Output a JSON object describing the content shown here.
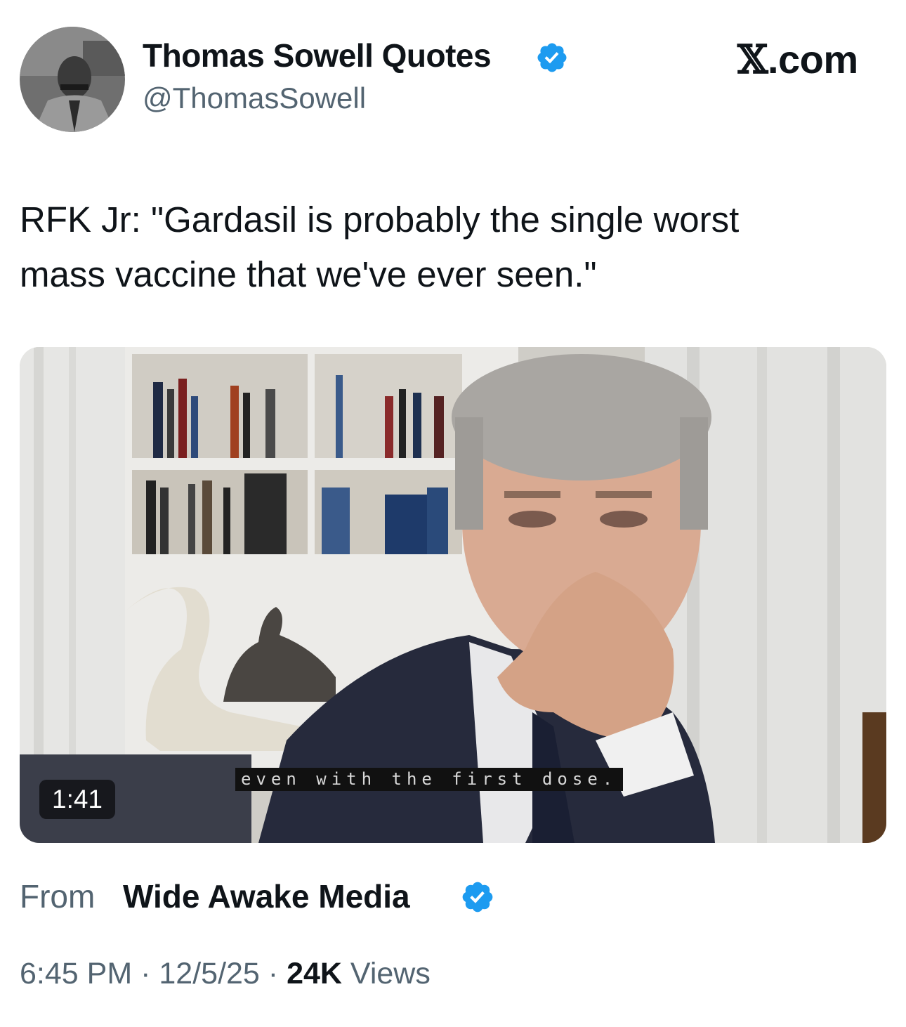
{
  "author": {
    "display_name": "Thomas Sowell Quotes",
    "handle": "@ThomasSowell",
    "verified_icon": "verified-badge-icon"
  },
  "site": {
    "logo_glyph": "𝕏",
    "logo_suffix": ".com"
  },
  "tweet": {
    "text_line1": "RFK Jr: \"Gardasil is probably the single worst",
    "text_line2": "mass vaccine that we've ever seen.\""
  },
  "media": {
    "duration": "1:41",
    "caption": "even with the first dose."
  },
  "source": {
    "prefix": "From",
    "name": "Wide Awake Media",
    "verified_icon": "verified-badge-icon"
  },
  "footer": {
    "time": "6:45 PM",
    "sep": "·",
    "date": "12/5/25",
    "views_count": "24K",
    "views_label": "Views"
  },
  "colors": {
    "verified": "#1d9bf0",
    "secondary_text": "#536471",
    "primary_text": "#0f1419"
  }
}
